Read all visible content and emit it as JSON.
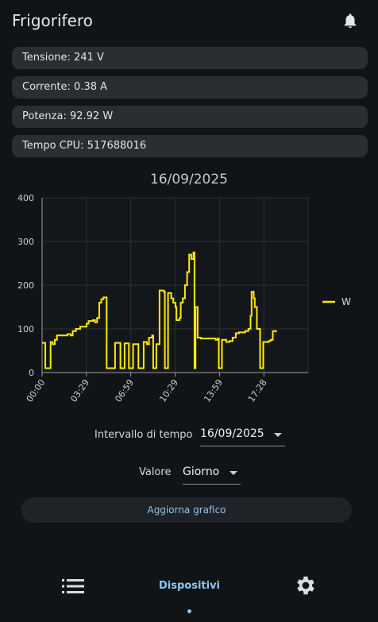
{
  "app": {
    "title": "Frigorifero"
  },
  "icons": {
    "notifications": "bell-icon",
    "list": "list-icon",
    "settings": "gear-icon"
  },
  "colors": {
    "accent": "#8fc5ef",
    "series": "#ffea00",
    "background": "#111416",
    "row": "#2a2d31"
  },
  "info": [
    {
      "text": "Tensione: 241 V"
    },
    {
      "text": "Corrente: 0.38 A"
    },
    {
      "text": "Potenza: 92.92 W"
    },
    {
      "text": "Tempo CPU: 517688016"
    }
  ],
  "chart_data": {
    "type": "line",
    "title": "16/09/2025",
    "xlabel": "",
    "ylabel": "",
    "x_ticks": [
      "00:00",
      "03:29",
      "06:59",
      "10:29",
      "13:59",
      "17:28"
    ],
    "y_ticks": [
      "0",
      "100",
      "200",
      "300",
      "400"
    ],
    "ylim": [
      0,
      400
    ],
    "grid": true,
    "legend": "right",
    "series": [
      {
        "name": "W",
        "color": "#ffea00",
        "points": [
          [
            "00:00",
            68
          ],
          [
            "00:10",
            68
          ],
          [
            "00:15",
            10
          ],
          [
            "00:35",
            10
          ],
          [
            "00:40",
            70
          ],
          [
            "00:50",
            65
          ],
          [
            "01:00",
            75
          ],
          [
            "01:10",
            85
          ],
          [
            "02:00",
            88
          ],
          [
            "02:15",
            85
          ],
          [
            "02:25",
            95
          ],
          [
            "02:40",
            100
          ],
          [
            "03:00",
            105
          ],
          [
            "03:30",
            112
          ],
          [
            "03:40",
            118
          ],
          [
            "04:00",
            120
          ],
          [
            "04:10",
            115
          ],
          [
            "04:20",
            125
          ],
          [
            "04:30",
            160
          ],
          [
            "04:40",
            168
          ],
          [
            "04:50",
            172
          ],
          [
            "05:00",
            172
          ],
          [
            "05:05",
            10
          ],
          [
            "05:40",
            10
          ],
          [
            "05:45",
            68
          ],
          [
            "06:05",
            68
          ],
          [
            "06:10",
            10
          ],
          [
            "06:25",
            10
          ],
          [
            "06:30",
            67
          ],
          [
            "06:45",
            67
          ],
          [
            "06:50",
            10
          ],
          [
            "07:05",
            10
          ],
          [
            "07:10",
            65
          ],
          [
            "07:30",
            65
          ],
          [
            "07:35",
            10
          ],
          [
            "07:55",
            10
          ],
          [
            "08:00",
            70
          ],
          [
            "08:15",
            65
          ],
          [
            "08:25",
            80
          ],
          [
            "08:40",
            85
          ],
          [
            "08:45",
            10
          ],
          [
            "08:55",
            10
          ],
          [
            "09:00",
            65
          ],
          [
            "09:10",
            65
          ],
          [
            "09:15",
            188
          ],
          [
            "09:35",
            185
          ],
          [
            "09:40",
            10
          ],
          [
            "09:50",
            10
          ],
          [
            "09:55",
            182
          ],
          [
            "10:10",
            170
          ],
          [
            "10:20",
            160
          ],
          [
            "10:30",
            150
          ],
          [
            "10:35",
            120
          ],
          [
            "10:50",
            125
          ],
          [
            "10:55",
            160
          ],
          [
            "11:05",
            170
          ],
          [
            "11:15",
            200
          ],
          [
            "11:25",
            230
          ],
          [
            "11:35",
            270
          ],
          [
            "11:45",
            260
          ],
          [
            "11:55",
            275
          ],
          [
            "12:00",
            10
          ],
          [
            "12:05",
            150
          ],
          [
            "12:15",
            80
          ],
          [
            "12:30",
            78
          ],
          [
            "13:00",
            78
          ],
          [
            "13:40",
            75
          ],
          [
            "13:50",
            78
          ],
          [
            "13:55",
            10
          ],
          [
            "14:05",
            10
          ],
          [
            "14:10",
            75
          ],
          [
            "14:30",
            70
          ],
          [
            "14:45",
            72
          ],
          [
            "15:00",
            80
          ],
          [
            "15:15",
            90
          ],
          [
            "15:30",
            92
          ],
          [
            "16:00",
            95
          ],
          [
            "16:15",
            100
          ],
          [
            "16:25",
            130
          ],
          [
            "16:30",
            185
          ],
          [
            "16:40",
            170
          ],
          [
            "16:45",
            150
          ],
          [
            "16:55",
            100
          ],
          [
            "17:05",
            100
          ],
          [
            "17:10",
            10
          ],
          [
            "17:20",
            10
          ],
          [
            "17:25",
            70
          ],
          [
            "17:50",
            72
          ],
          [
            "18:00",
            75
          ],
          [
            "18:10",
            95
          ],
          [
            "18:25",
            92
          ]
        ]
      }
    ]
  },
  "controls": {
    "interval_label": "Intervallo di tempo",
    "interval_value": "16/09/2025",
    "value_label": "Valore",
    "value_value": "Giorno",
    "refresh_label": "Aggiorna grafico"
  },
  "nav": {
    "devices_label": "Dispositivi"
  }
}
